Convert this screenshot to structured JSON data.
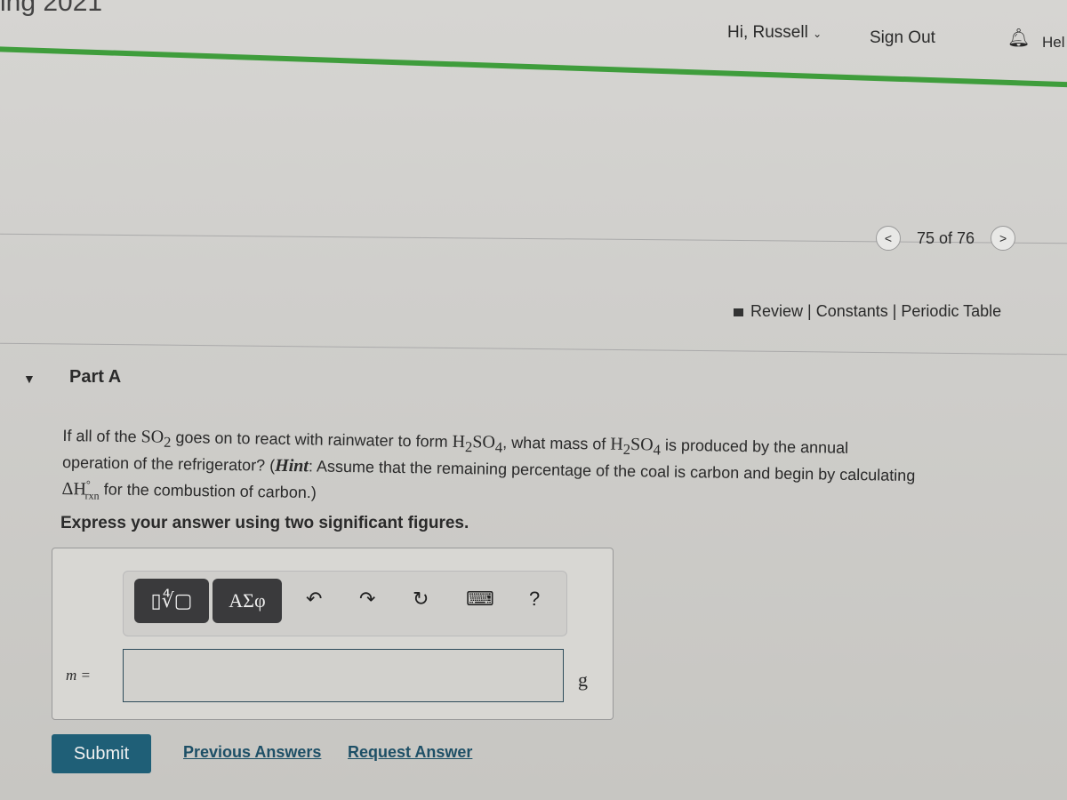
{
  "header": {
    "course_fragment": "ing 2021",
    "greeting": "Hi, Russell",
    "sign_out": "Sign Out",
    "help": "Hel",
    "accent": "#3f9d3c"
  },
  "pager": {
    "prev": "<",
    "text": "75 of 76",
    "next": ">"
  },
  "resources": {
    "text": "Review | Constants | Periodic Table"
  },
  "part": {
    "label": "Part A"
  },
  "question": {
    "p1": "If all of the ",
    "so2": "SO",
    "so2_sub": "2",
    "p2": " goes on to react with rainwater to form ",
    "h2so4a": "H",
    "sub2": "2",
    "so4": "SO",
    "sub4": "4",
    "p3": ", what mass of ",
    "p4": " is produced by the annual",
    "line2a": "operation of the refrigerator? (",
    "hint": "Hint",
    "line2b": ": Assume that the remaining percentage of the coal is carbon and begin by calculating",
    "dh": "ΔH",
    "dh_sup": "°",
    "dh_sub": "rxn",
    "line3": " for the combustion of carbon.)"
  },
  "instruction": "Express your answer using two significant figures.",
  "toolbar": {
    "templates": "▯∜▢",
    "greek": "ΑΣφ",
    "undo": "↶",
    "redo": "↷",
    "reset": "↻",
    "keyboard": "⌨",
    "help": "?"
  },
  "answer": {
    "label": "m =",
    "value": "",
    "unit": "g"
  },
  "actions": {
    "submit": "Submit",
    "previous": "Previous Answers",
    "request": "Request Answer"
  }
}
